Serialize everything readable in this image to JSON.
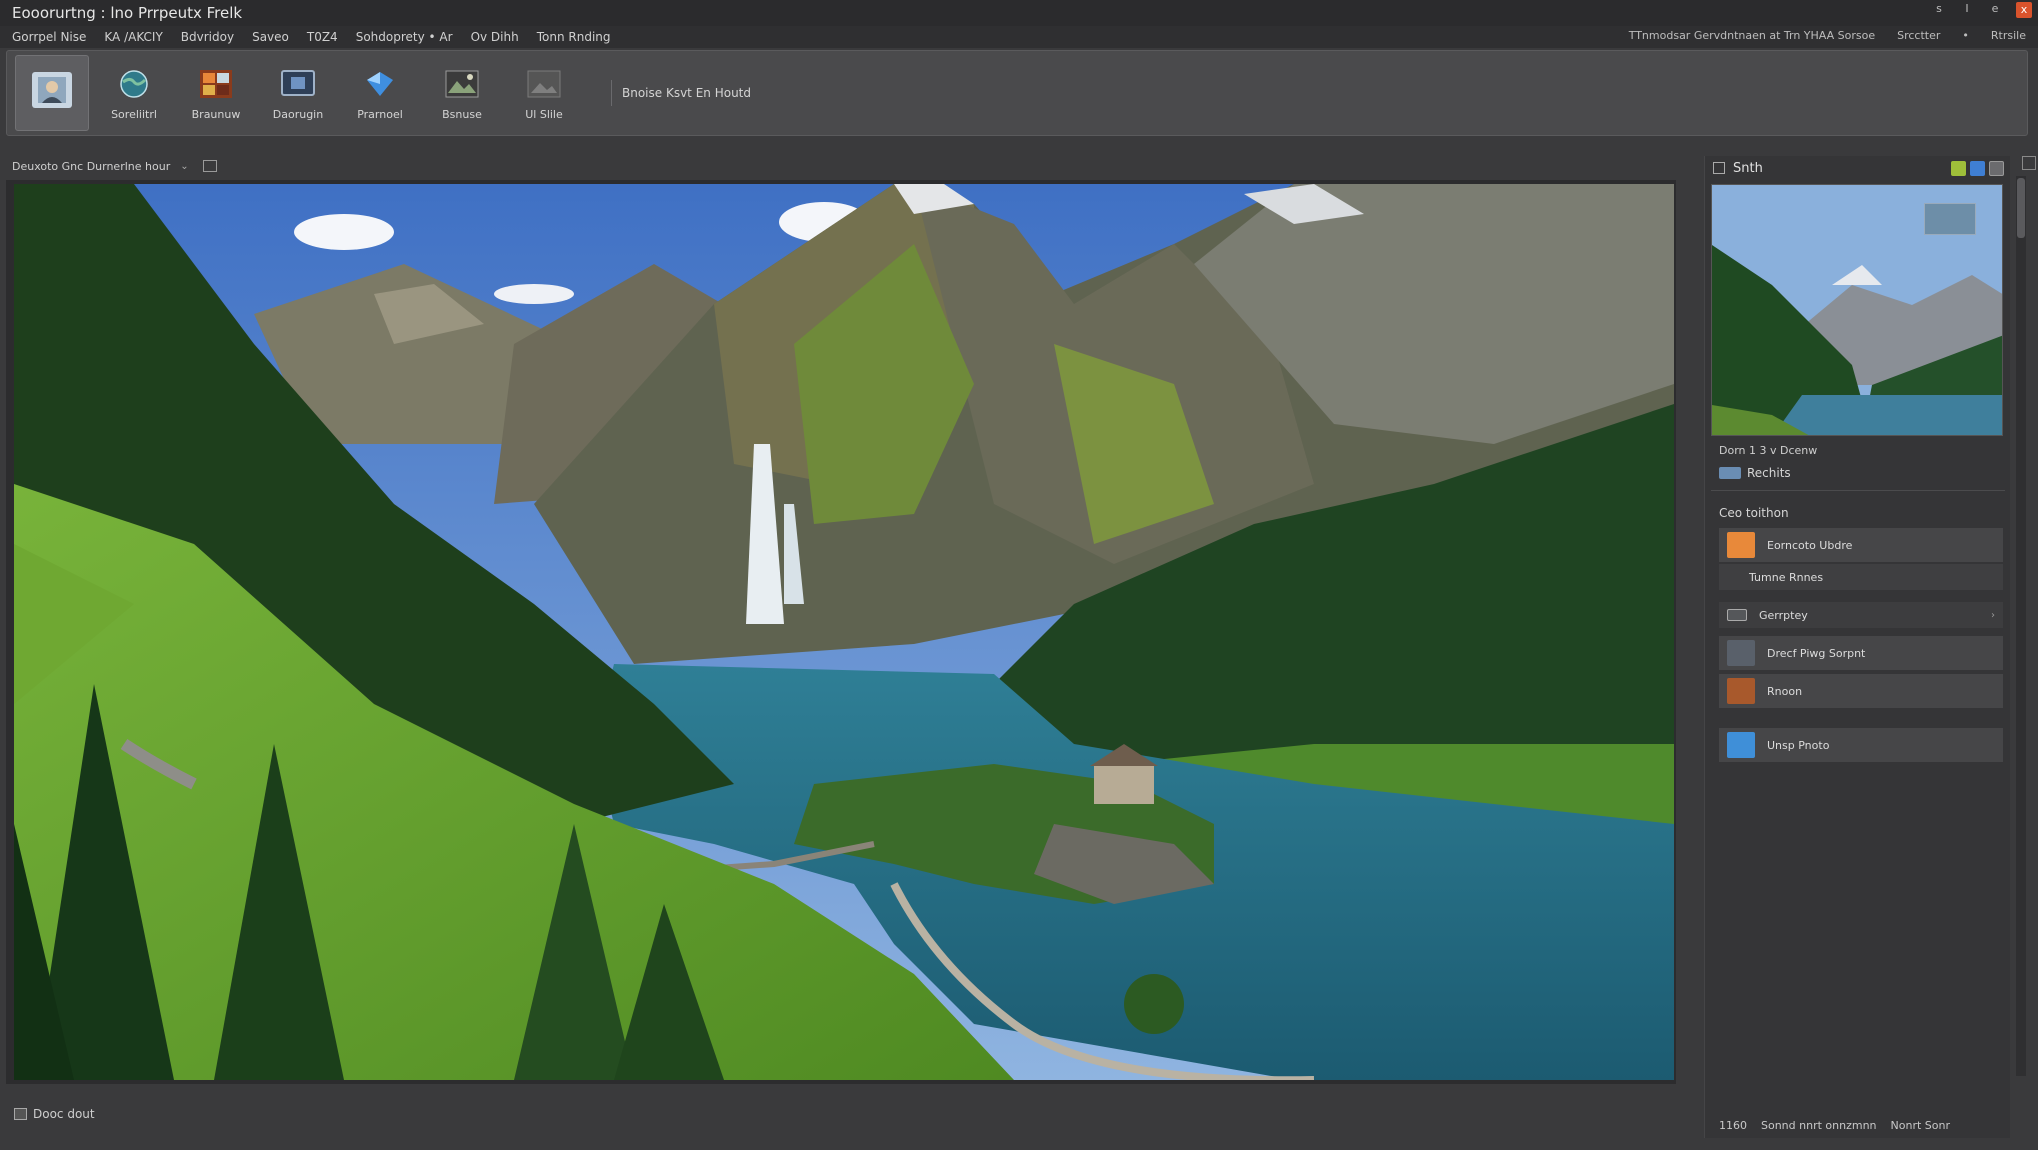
{
  "window": {
    "title": "Eooorurtng : lno Prrpeutx Frelk",
    "controls": [
      "s",
      "I",
      "e",
      "x"
    ]
  },
  "menubar": {
    "items": [
      "Gorrpel Nise",
      "KA /AKCIY",
      "Bdvridoy",
      "Saveo",
      "T0Z4",
      "Sohdoprety • Ar",
      "Ov Dihh",
      "Tonn Rnding"
    ],
    "right_items": [
      "TTnmodsar Gervdntnaen at Trn YHAA Sorsoe",
      "Srcctter",
      "•",
      "Rtrsile"
    ]
  },
  "toolbar": {
    "tools": [
      {
        "label": "",
        "icon": "portrait-icon"
      },
      {
        "label": "Soreliitrl",
        "icon": "globe-icon"
      },
      {
        "label": "Braunuw",
        "icon": "brush-palette-icon"
      },
      {
        "label": "Daorugin",
        "icon": "monitor-icon"
      },
      {
        "label": "Prarnoel",
        "icon": "diamond-icon"
      },
      {
        "label": "Bsnuse",
        "icon": "image-icon"
      },
      {
        "label": "Ul Slile",
        "icon": "photo-frame-icon"
      }
    ],
    "extra_text": "Bnoise Ksvt   En Houtd"
  },
  "document": {
    "tab_label": "Deuxoto Gnc Durnerlne hour",
    "status_text": "Dooc dout"
  },
  "panel": {
    "title": "Snth",
    "info_line": "Dorn 1  3  v  Dcenw",
    "sub_label": "Rechits",
    "section_title": "Ceo toithon",
    "rows": [
      {
        "label": "Eorncoto Ubdre",
        "icon": "orange-square-icon",
        "kind": "item"
      },
      {
        "label": "Tumne Rnnes",
        "icon": "",
        "kind": "sub"
      },
      {
        "label": "Gerrptey",
        "icon": "folder-icon",
        "kind": "header"
      },
      {
        "label": "Drecf Piwg Sorpnt",
        "icon": "layers-icon",
        "kind": "item"
      },
      {
        "label": "Rnoon",
        "icon": "photo-icon",
        "kind": "item"
      },
      {
        "label": "Unsp Pnoto",
        "icon": "landscape-icon",
        "kind": "item"
      }
    ],
    "status": [
      "1160",
      "Sonnd nnrt onnzmnn",
      "Nonrt Sonr"
    ]
  },
  "colors": {
    "bg": "#3a3a3c",
    "toolbar": "#4a4a4c",
    "panel": "#353537",
    "accent_close": "#d9532c"
  }
}
